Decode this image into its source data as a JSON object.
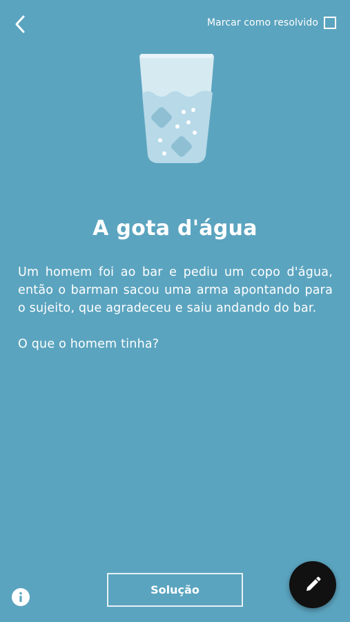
{
  "header": {
    "back_icon": "chevron-left-icon",
    "mark_resolved_label": "Marcar como resolvido",
    "mark_resolved_checked": false
  },
  "illustration": {
    "icon": "water-glass-icon"
  },
  "puzzle": {
    "title": "A gota d'água",
    "statement": "Um homem foi ao bar e pediu um copo d'água, então o barman sacou uma arma apontando para o sujeito, que agradeceu e saiu andando do bar.",
    "question": "O que o homem tinha?"
  },
  "footer": {
    "solution_label": "Solução",
    "info_icon": "info-icon",
    "edit_icon": "pencil-icon"
  },
  "colors": {
    "background": "#5ba4bf",
    "text": "#ffffff",
    "fab": "#111111"
  }
}
